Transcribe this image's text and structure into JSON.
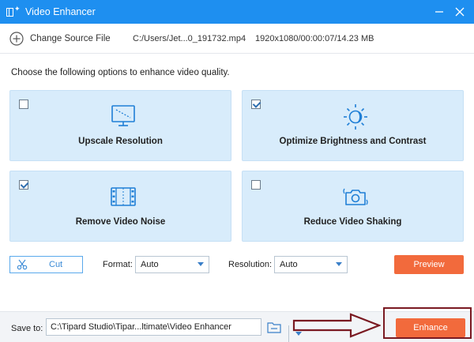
{
  "window": {
    "title": "Video Enhancer"
  },
  "source": {
    "change_label": "Change Source File",
    "file_path": "C:/Users/Jet...0_191732.mp4",
    "file_info": "1920x1080/00:00:07/14.23 MB"
  },
  "instructions": "Choose the following options to enhance video quality.",
  "options": [
    {
      "label": "Upscale Resolution",
      "checked": false,
      "icon": "monitor-upscale-icon"
    },
    {
      "label": "Optimize Brightness and Contrast",
      "checked": true,
      "icon": "brightness-icon"
    },
    {
      "label": "Remove Video Noise",
      "checked": true,
      "icon": "film-noise-icon"
    },
    {
      "label": "Reduce Video Shaking",
      "checked": false,
      "icon": "camera-shake-icon"
    }
  ],
  "controls": {
    "cut_label": "Cut",
    "format_label": "Format:",
    "format_value": "Auto",
    "resolution_label": "Resolution:",
    "resolution_value": "Auto",
    "preview_label": "Preview"
  },
  "footer": {
    "save_label": "Save to:",
    "save_path": "C:\\Tipard Studio\\Tipar...ltimate\\Video Enhancer",
    "enhance_label": "Enhance"
  },
  "colors": {
    "titlebar": "#1e8ff0",
    "card_bg": "#d8ecfb",
    "accent_orange": "#f26a3c",
    "annotation": "#7a1a22",
    "icon_blue": "#1f7fd6"
  }
}
